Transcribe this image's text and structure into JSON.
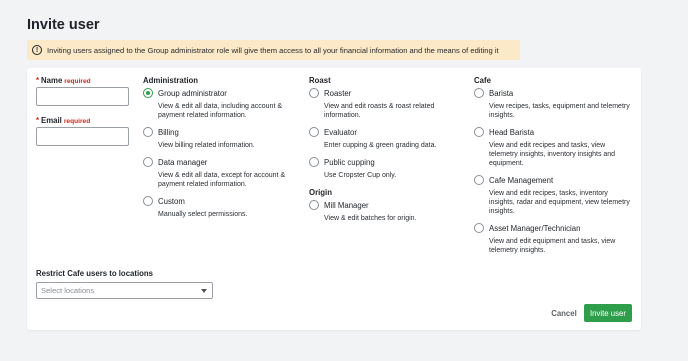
{
  "page_title": "Invite user",
  "warning": {
    "icon": "exclamation-circle-icon",
    "text": "Inviting users assigned to the Group administrator role will give them access to all your financial information and the means of editing it"
  },
  "form": {
    "name": {
      "star": "*",
      "label": "Name",
      "required": "required",
      "value": ""
    },
    "email": {
      "star": "*",
      "label": "Email",
      "required": "required",
      "value": ""
    }
  },
  "groups": {
    "administration": {
      "title": "Administration",
      "options": [
        {
          "label": "Group administrator",
          "desc": "View & edit all data, including account & payment related information.",
          "checked": true
        },
        {
          "label": "Billing",
          "desc": "View billing related information.",
          "checked": false
        },
        {
          "label": "Data manager",
          "desc": "View & edit all data, except for account & payment related information.",
          "checked": false
        },
        {
          "label": "Custom",
          "desc": "Manually select permissions.",
          "checked": false
        }
      ]
    },
    "roast": {
      "title": "Roast",
      "options": [
        {
          "label": "Roaster",
          "desc": "View and edit roasts & roast related information.",
          "checked": false
        },
        {
          "label": "Evaluator",
          "desc": "Enter cupping & green grading data.",
          "checked": false
        },
        {
          "label": "Public cupping",
          "desc": "Use Cropster Cup only.",
          "checked": false
        }
      ]
    },
    "origin": {
      "title": "Origin",
      "options": [
        {
          "label": "Mill Manager",
          "desc": "View & edit batches for origin.",
          "checked": false
        }
      ]
    },
    "cafe": {
      "title": "Cafe",
      "options": [
        {
          "label": "Barista",
          "desc": "View recipes, tasks, equipment and telemetry insights.",
          "checked": false
        },
        {
          "label": "Head Barista",
          "desc": "View and edit recipes and tasks, view telemetry insights, inventory insights and equipment.",
          "checked": false
        },
        {
          "label": "Cafe Management",
          "desc": "View and edit recipes, tasks, inventory insights, radar and equipment, view telemetry insights.",
          "checked": false
        },
        {
          "label": "Asset Manager/Technician",
          "desc": "View and edit equipment and tasks, view telemetry insights.",
          "checked": false
        }
      ]
    }
  },
  "restrict": {
    "label": "Restrict Cafe users to locations",
    "placeholder": "Select locations"
  },
  "actions": {
    "cancel": "Cancel",
    "invite": "Invite user"
  },
  "colors": {
    "accent": "#2e9e4a",
    "required": "#d0261d",
    "warning_bg": "#fbe9c8",
    "page_bg": "#f2f3f5"
  }
}
